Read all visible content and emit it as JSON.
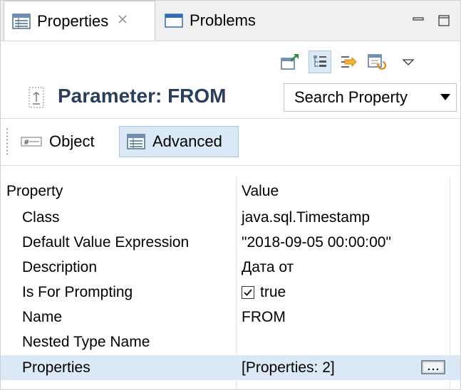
{
  "tabs": {
    "properties_label": "Properties",
    "problems_label": "Problems"
  },
  "title": {
    "text": "Parameter: FROM"
  },
  "search": {
    "value": "Search Property"
  },
  "subtabs": {
    "object_label": "Object",
    "advanced_label": "Advanced"
  },
  "table": {
    "headers": {
      "property": "Property",
      "value": "Value"
    },
    "rows": [
      {
        "property": "Class",
        "value": "java.sql.Timestamp"
      },
      {
        "property": "Default Value Expression",
        "value": "\"2018-09-05 00:00:00\""
      },
      {
        "property": "Description",
        "value": "Дата от"
      },
      {
        "property": "Is For Prompting",
        "value": "true"
      },
      {
        "property": "Name",
        "value": "FROM"
      },
      {
        "property": "Nested Type Name",
        "value": ""
      },
      {
        "property": "Properties",
        "value": "[Properties: 2]"
      }
    ]
  },
  "colors": {
    "selection": "#dbe8f6",
    "title_text": "#2b3f5c",
    "tab_bar": "#f0f0f0"
  }
}
